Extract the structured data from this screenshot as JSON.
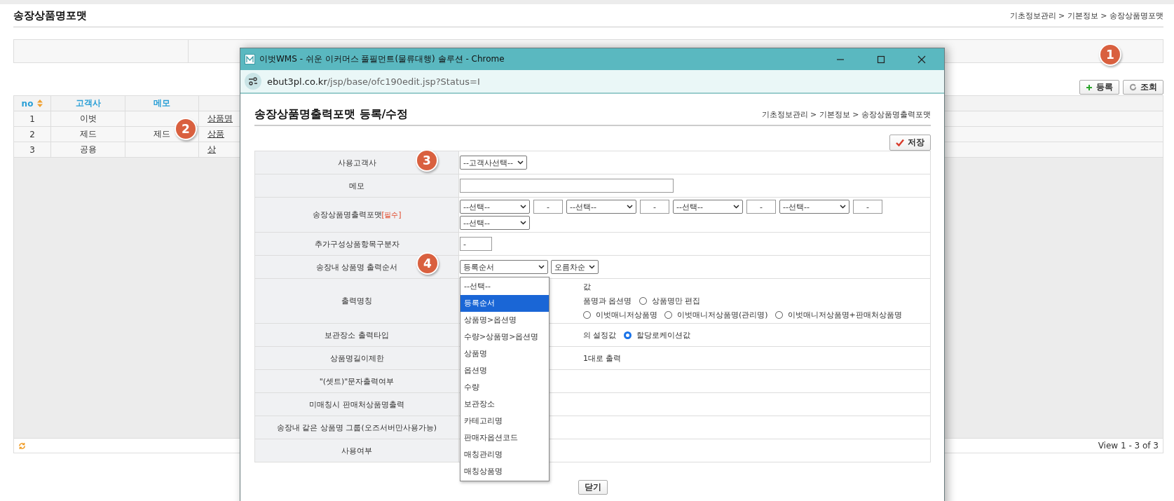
{
  "page": {
    "title": "송장상품명포맷",
    "breadcrumb": "기초정보관리 > 기본정보 > 송장상품명포맷"
  },
  "toolbar": {
    "buttons": [
      {
        "label": "등록",
        "kind": "add"
      },
      {
        "label": "조회",
        "kind": "refresh"
      }
    ]
  },
  "grid": {
    "columns": [
      {
        "label": "no",
        "sortable": true
      },
      {
        "label": "고객사",
        "sortable": false
      },
      {
        "label": "메모",
        "sortable": false
      }
    ],
    "rows": [
      {
        "no": "1",
        "customer": "이벗",
        "format": "상품명"
      },
      {
        "no": "2",
        "customer": "제드",
        "memo": "제드",
        "format": "상품"
      },
      {
        "no": "3",
        "customer": "공용",
        "format": "상"
      }
    ],
    "footer": "View 1 - 3 of 3"
  },
  "badges": [
    "1",
    "2",
    "3",
    "4"
  ],
  "popup": {
    "title": "이벗WMS - 쉬운 이커머스 풀필먼트(물류대행) 솔루션 - Chrome",
    "url_host": "ebut3pl.co.kr",
    "url_path": "/jsp/base/ofc190edit.jsp?Status=I",
    "heading": "송장상품명출력포맷 등록/수정",
    "breadcrumb": "기초정보관리 > 기본정보 > 송장상품명출력포맷",
    "save": "저장",
    "close": "닫기",
    "rows": [
      {
        "label": "사용고객사",
        "kind": "select",
        "value": "--고객사선택--"
      },
      {
        "label": "메모",
        "kind": "text"
      },
      {
        "label": "송장상품명출력포맷",
        "required": "[필수]",
        "kind": "format",
        "selects": [
          "--선택--",
          "--선택--",
          "--선택--",
          "--선택--",
          "--선택--"
        ],
        "separators": [
          "-",
          "-",
          "-",
          "-"
        ]
      },
      {
        "label": "추가구성상품항목구분자",
        "kind": "short",
        "value": "-"
      },
      {
        "label": "송장내 상품명 출력순서",
        "kind": "order",
        "selects": [
          "등록순서",
          "오름차순"
        ]
      },
      {
        "label": "출력명칭",
        "kind": "lines",
        "lines": [
          [
            {
              "kind": "text",
              "label": "값"
            }
          ],
          [
            {
              "kind": "text",
              "label": "품명과 옵션명"
            },
            {
              "kind": "radio",
              "checked": false,
              "label": "상품명만 편집"
            }
          ],
          [
            {
              "kind": "radio",
              "checked": false,
              "label": "이벗매니저상품명"
            },
            {
              "kind": "radio",
              "checked": false,
              "label": "이벗매니저상품명(관리명)"
            },
            {
              "kind": "radio",
              "checked": false,
              "label": "이벗매니저상품명+판매처상품명"
            }
          ]
        ]
      },
      {
        "label": "보관장소 출력타입",
        "kind": "lines",
        "lines": [
          [
            {
              "kind": "text",
              "label": "의 설정값"
            },
            {
              "kind": "radio",
              "checked": true,
              "label": "할당로케이션값"
            }
          ]
        ]
      },
      {
        "label": "상품명길이제한",
        "kind": "lines",
        "lines": [
          [
            {
              "kind": "text",
              "label": "1대로 출력"
            }
          ]
        ]
      },
      {
        "label": "\"(셋트)\"문자출력여부",
        "kind": "empty"
      },
      {
        "label": "미매칭시 판매처상품명출력",
        "kind": "empty"
      },
      {
        "label": "송장내 같은 상품명 그룹(오즈서버만사용가능)",
        "kind": "empty"
      },
      {
        "label": "사용여부",
        "kind": "empty"
      }
    ],
    "dropdown": [
      {
        "label": "--선택--",
        "selected": false
      },
      {
        "label": "등록순서",
        "selected": true
      },
      {
        "label": "상품명>옵션명",
        "selected": false
      },
      {
        "label": "수량>상품명>옵션명",
        "selected": false
      },
      {
        "label": "상품명",
        "selected": false
      },
      {
        "label": "옵션명",
        "selected": false
      },
      {
        "label": "수량",
        "selected": false
      },
      {
        "label": "보관장소",
        "selected": false
      },
      {
        "label": "카테고리명",
        "selected": false
      },
      {
        "label": "판매자옵션코드",
        "selected": false
      },
      {
        "label": "매칭관리명",
        "selected": false
      },
      {
        "label": "매칭상품명",
        "selected": false
      }
    ]
  }
}
